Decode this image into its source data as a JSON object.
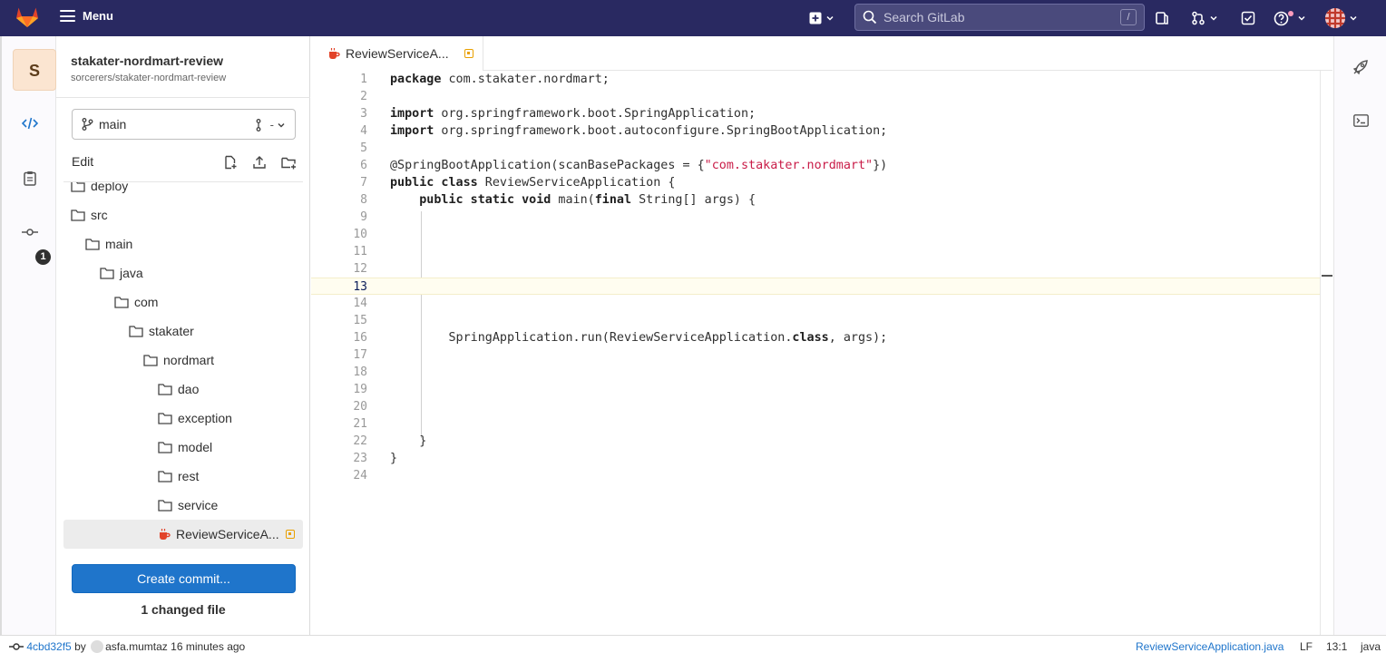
{
  "topbar": {
    "menu_label": "Menu",
    "search_placeholder": "Search GitLab",
    "search_shortcut": "/"
  },
  "project": {
    "avatar_letter": "S",
    "name": "stakater-nordmart-review",
    "path": "sorcerers/stakater-nordmart-review"
  },
  "rail": {
    "commit_badge": "1"
  },
  "branch": {
    "name": "main",
    "right_text": "-"
  },
  "edit": {
    "label": "Edit"
  },
  "tree": [
    {
      "name": "deploy",
      "type": "folder",
      "depth": 0
    },
    {
      "name": "src",
      "type": "folder",
      "depth": 0
    },
    {
      "name": "main",
      "type": "folder",
      "depth": 1
    },
    {
      "name": "java",
      "type": "folder",
      "depth": 2
    },
    {
      "name": "com",
      "type": "folder",
      "depth": 3
    },
    {
      "name": "stakater",
      "type": "folder",
      "depth": 4
    },
    {
      "name": "nordmart",
      "type": "folder",
      "depth": 5
    },
    {
      "name": "dao",
      "type": "folder",
      "depth": 6
    },
    {
      "name": "exception",
      "type": "folder",
      "depth": 6
    },
    {
      "name": "model",
      "type": "folder",
      "depth": 6
    },
    {
      "name": "rest",
      "type": "folder",
      "depth": 6
    },
    {
      "name": "service",
      "type": "folder",
      "depth": 6
    },
    {
      "name": "ReviewServiceA...",
      "type": "java-file",
      "depth": 6,
      "active": true,
      "modified": true
    }
  ],
  "commit": {
    "button_label": "Create commit...",
    "changed_text": "1 changed file"
  },
  "editor": {
    "tab_label": "ReviewServiceA...",
    "current_line": 13,
    "lines": [
      [
        [
          "kw",
          "package"
        ],
        [
          "t",
          " com.stakater.nordmart;"
        ]
      ],
      [],
      [
        [
          "kw",
          "import"
        ],
        [
          "t",
          " org.springframework.boot.SpringApplication;"
        ]
      ],
      [
        [
          "kw",
          "import"
        ],
        [
          "t",
          " org.springframework.boot.autoconfigure.SpringBootApplication;"
        ]
      ],
      [],
      [
        [
          "t",
          "@SpringBootApplication(scanBasePackages = {"
        ],
        [
          "str",
          "\"com.stakater.nordmart\""
        ],
        [
          "t",
          "})"
        ]
      ],
      [
        [
          "kw",
          "public class"
        ],
        [
          "t",
          " ReviewServiceApplication {"
        ]
      ],
      [
        [
          "t",
          "    "
        ],
        [
          "kw",
          "public static void"
        ],
        [
          "t",
          " main("
        ],
        [
          "kw",
          "final"
        ],
        [
          "t",
          " String[] args) {"
        ]
      ],
      [],
      [],
      [],
      [],
      [],
      [],
      [],
      [
        [
          "t",
          "        SpringApplication.run(ReviewServiceApplication."
        ],
        [
          "kw",
          "class"
        ],
        [
          "t",
          ", args);"
        ]
      ],
      [],
      [],
      [],
      [],
      [],
      [
        [
          "t",
          "    }"
        ]
      ],
      [
        [
          "t",
          "}"
        ]
      ],
      []
    ]
  },
  "status": {
    "commit_sha": "4cbd32f5",
    "by_text": "by",
    "author": "asfa.mumtaz",
    "time_ago": "16 minutes ago",
    "file_name": "ReviewServiceApplication.java",
    "line_ending": "LF",
    "cursor_pos": "13:1",
    "language": "java"
  },
  "colors": {
    "navbar": "#292961",
    "primary": "#1f75cb",
    "string": "#c91c48",
    "modified": "#e9a000"
  }
}
